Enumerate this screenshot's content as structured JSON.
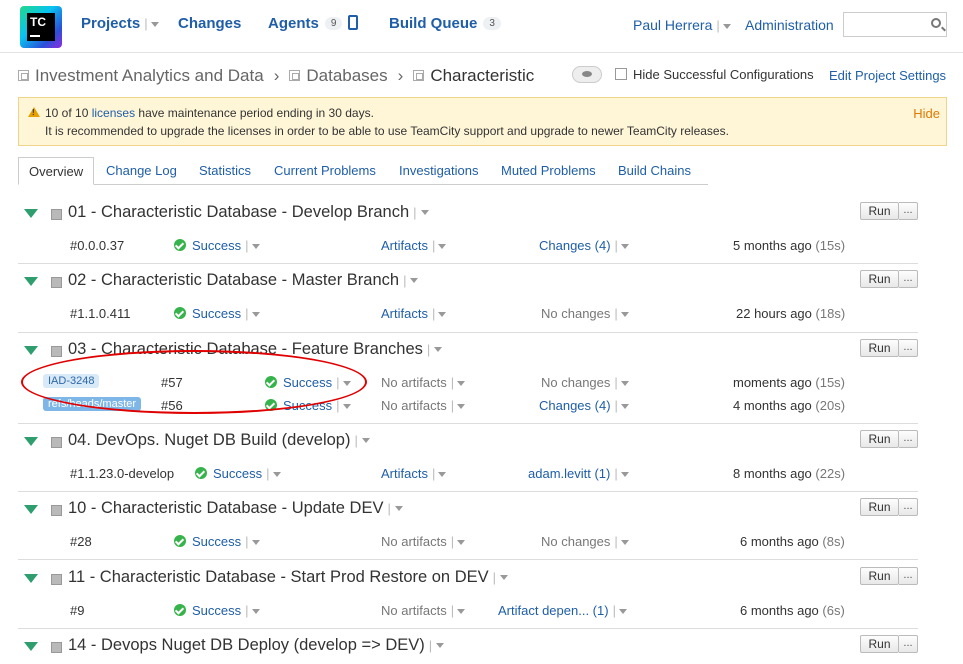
{
  "header": {
    "logo_text": "TC",
    "nav": [
      {
        "label": "Projects"
      },
      {
        "label": "Changes"
      },
      {
        "label": "Agents",
        "count": "9"
      },
      {
        "label": "Build Queue",
        "count": "3"
      }
    ],
    "user": "Paul Herrera",
    "admin": "Administration",
    "search_placeholder": ""
  },
  "breadcrumb": {
    "items": [
      "Investment Analytics and Data",
      "Databases",
      "Characteristic"
    ],
    "separator": "›",
    "hide_successful": "Hide Successful Configurations",
    "edit_settings": "Edit Project Settings"
  },
  "banner": {
    "line1_prefix": "10 of 10",
    "line1_link": "licenses",
    "line1_suffix": "have maintenance period ending in 30 days.",
    "line2": "It is recommended to upgrade the licenses in order to be able to use TeamCity support and upgrade to newer TeamCity releases.",
    "hide": "Hide"
  },
  "tabs": [
    "Overview",
    "Change Log",
    "Statistics",
    "Current Problems",
    "Investigations",
    "Muted Problems",
    "Build Chains"
  ],
  "buttons": {
    "run": "Run",
    "more": "..."
  },
  "configs": [
    {
      "name": "01 - Characteristic Database - Develop Branch",
      "builds": [
        {
          "number": "#0.0.0.37",
          "status": "Success",
          "artifacts": "Artifacts",
          "changes": "Changes (4)",
          "when": "5 months ago",
          "dur": "(15s)"
        }
      ]
    },
    {
      "name": "02 - Characteristic Database - Master Branch",
      "builds": [
        {
          "number": "#1.1.0.411",
          "status": "Success",
          "artifacts": "Artifacts",
          "changes": "No changes",
          "when": "22 hours ago",
          "dur": "(18s)"
        }
      ]
    },
    {
      "name": "03 - Characteristic Database - Feature Branches",
      "builds": [
        {
          "branch": "IAD-3248",
          "number": "#57",
          "status": "Success",
          "artifacts": "No artifacts",
          "changes": "No changes",
          "when": "moments ago",
          "dur": "(15s)"
        },
        {
          "branch": "refs/heads/master",
          "number": "#56",
          "status": "Success",
          "artifacts": "No artifacts",
          "changes": "Changes (4)",
          "when": "4 months ago",
          "dur": "(20s)"
        }
      ]
    },
    {
      "name": "04. DevOps. Nuget DB Build (develop)",
      "builds": [
        {
          "number": "#1.1.23.0-develop",
          "status": "Success",
          "artifacts": "Artifacts",
          "changes": "adam.levitt (1)",
          "when": "8 months ago",
          "dur": "(22s)"
        }
      ]
    },
    {
      "name": "10 - Characteristic Database - Update DEV",
      "builds": [
        {
          "number": "#28",
          "status": "Success",
          "artifacts": "No artifacts",
          "changes": "No changes",
          "when": "6 months ago",
          "dur": "(8s)"
        }
      ]
    },
    {
      "name": "11 - Characteristic Database - Start Prod Restore on DEV",
      "builds": [
        {
          "number": "#9",
          "status": "Success",
          "artifacts": "No artifacts",
          "changes": "Artifact depen... (1)",
          "when": "6 months ago",
          "dur": "(6s)"
        }
      ]
    },
    {
      "name": "14 - Devops Nuget DB Deploy (develop => DEV)",
      "builds": []
    }
  ]
}
